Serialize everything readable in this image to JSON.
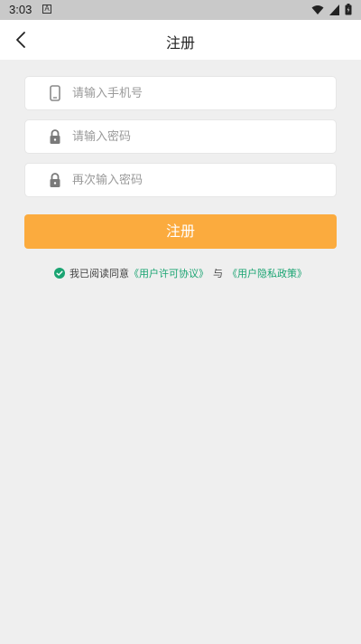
{
  "status_bar": {
    "time": "3:03",
    "app_indicator": "A",
    "icons": [
      "wifi-icon",
      "signal-icon",
      "battery-icon"
    ]
  },
  "app_bar": {
    "title": "注册",
    "back_icon": "chevron-left-icon"
  },
  "form": {
    "phone": {
      "placeholder": "请输入手机号",
      "value": "",
      "icon": "phone-icon"
    },
    "password": {
      "placeholder": "请输入密码",
      "value": "",
      "icon": "lock-icon"
    },
    "confirm_password": {
      "placeholder": "再次输入密码",
      "value": "",
      "icon": "lock-icon"
    },
    "submit_label": "注册"
  },
  "agreement": {
    "checked": true,
    "prefix": "我已阅读同意",
    "user_agreement": "《用户许可协议》",
    "conjunction": "与",
    "privacy_policy": "《用户隐私政策》"
  },
  "colors": {
    "primary_button": "#fbab3e",
    "link": "#1aa472",
    "background": "#efefef"
  }
}
